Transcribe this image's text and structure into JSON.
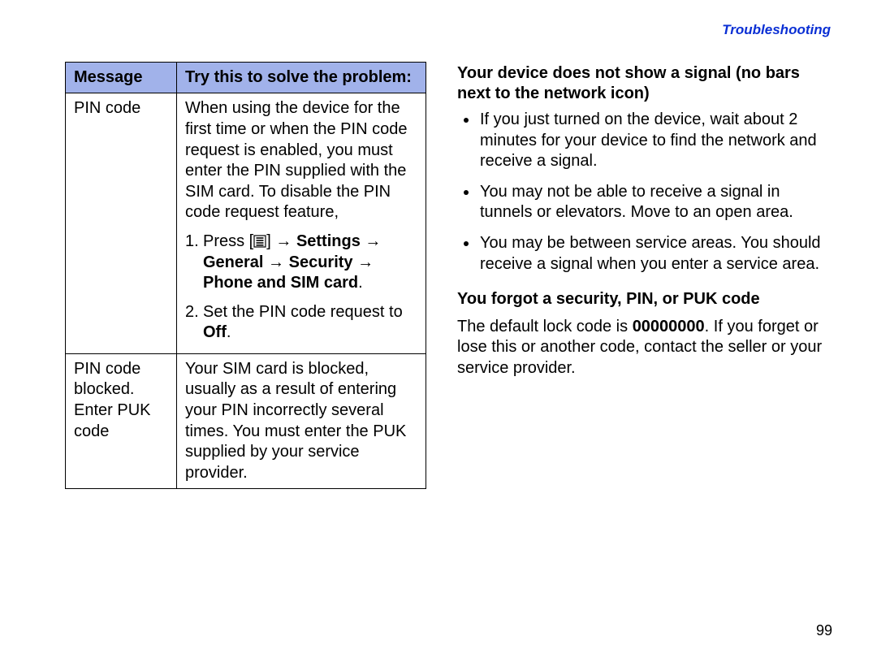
{
  "header": "Troubleshooting",
  "pageNumber": "99",
  "table": {
    "headers": {
      "msg": "Message",
      "solve": "Try this to solve the problem:"
    },
    "rows": [
      {
        "msg": "PIN code",
        "intro": "When using the device for the first time or when the PIN code request is enabled, you must enter the PIN supplied with the SIM card. To disable the PIN code request feature,",
        "step1_num": "1.",
        "step1_press": "Press [",
        "step1_after_icon_a": "] ",
        "arrow": "→",
        "settings": "Settings",
        "general": "General",
        "security": "Security",
        "phone_sim": "Phone and SIM card",
        "period": ".",
        "step2_num": "2.",
        "step2_a": "Set the PIN code request to ",
        "off": "Off",
        "step2_b": "."
      },
      {
        "msg": "PIN code blocked. Enter PUK code",
        "solve": "Your SIM card is blocked, usually as a result of entering your PIN incorrectly several times. You must enter the PUK supplied by your service provider."
      }
    ]
  },
  "right": {
    "title1": "Your device does not show a signal (no bars next to the network icon)",
    "bullets": [
      "If you just turned on the device, wait about 2 minutes for your device to find the network and receive a signal.",
      "You may not be able to receive a signal in tunnels or elevators. Move to an open area.",
      "You may be between service areas. You should receive a signal when you enter a service area."
    ],
    "title2": "You forgot a security, PIN, or PUK code",
    "para_a": "The default lock code is ",
    "code": "00000000",
    "para_b": ". If you forget or lose this or another code, contact the seller or your service provider."
  }
}
